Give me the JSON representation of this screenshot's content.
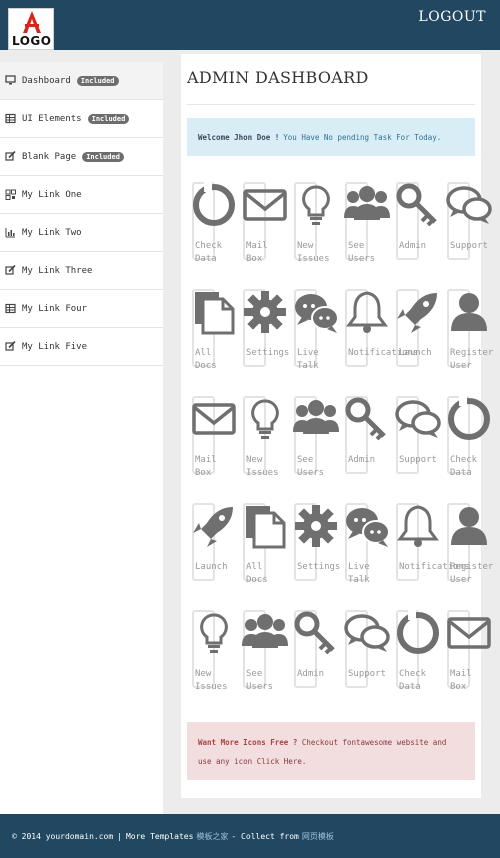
{
  "header": {
    "logo_text": "LOGO",
    "logout_label": "LOGOUT"
  },
  "sidebar": {
    "items": [
      {
        "label": "Dashboard",
        "badge": "Included",
        "icon": "desktop-icon",
        "active": true
      },
      {
        "label": "UI Elements",
        "badge": "Included",
        "icon": "table-icon"
      },
      {
        "label": "Blank Page",
        "badge": "Included",
        "icon": "edit-icon"
      },
      {
        "label": "My Link One",
        "badge": "",
        "icon": "qrcode-icon"
      },
      {
        "label": "My Link Two",
        "badge": "",
        "icon": "bar-chart-icon"
      },
      {
        "label": "My Link Three",
        "badge": "",
        "icon": "edit-icon"
      },
      {
        "label": "My Link Four",
        "badge": "",
        "icon": "table-icon"
      },
      {
        "label": "My Link Five",
        "badge": "",
        "icon": "edit-icon"
      }
    ]
  },
  "main": {
    "title": "ADMIN DASHBOARD",
    "info_alert": {
      "bold": "Welcome Jhon Doe !",
      "text": "You Have No pending Task For Today."
    },
    "tiles": [
      [
        {
          "label": "Check\nData",
          "icon": "circle-notch-icon"
        },
        {
          "label": "Mail\nBox",
          "icon": "envelope-icon"
        },
        {
          "label": "New\nIssues",
          "icon": "lightbulb-icon"
        },
        {
          "label": "See\nUsers",
          "icon": "users-icon"
        },
        {
          "label": "Admin",
          "icon": "key-icon"
        },
        {
          "label": "Support",
          "icon": "comments-icon"
        }
      ],
      [
        {
          "label": "All\nDocs",
          "icon": "files-icon"
        },
        {
          "label": "Settings",
          "icon": "gear-icon"
        },
        {
          "label": "Live\nTalk",
          "icon": "chat-bubbles-icon"
        },
        {
          "label": "Notifications",
          "icon": "bell-icon"
        },
        {
          "label": "Launch",
          "icon": "rocket-icon"
        },
        {
          "label": "Register\nUser",
          "icon": "user-icon"
        }
      ],
      [
        {
          "label": "Mail\nBox",
          "icon": "envelope-icon"
        },
        {
          "label": "New\nIssues",
          "icon": "lightbulb-icon"
        },
        {
          "label": "See\nUsers",
          "icon": "users-icon"
        },
        {
          "label": "Admin",
          "icon": "key-icon"
        },
        {
          "label": "Support",
          "icon": "comments-icon"
        },
        {
          "label": "Check\nData",
          "icon": "circle-notch-icon"
        }
      ],
      [
        {
          "label": "Launch",
          "icon": "rocket-icon"
        },
        {
          "label": "All\nDocs",
          "icon": "files-icon"
        },
        {
          "label": "Settings",
          "icon": "gear-icon"
        },
        {
          "label": "Live\nTalk",
          "icon": "chat-bubbles-icon"
        },
        {
          "label": "Notifications",
          "icon": "bell-icon"
        },
        {
          "label": "Register\nUser",
          "icon": "user-icon"
        }
      ],
      [
        {
          "label": "New\nIssues",
          "icon": "lightbulb-icon"
        },
        {
          "label": "See\nUsers",
          "icon": "users-icon"
        },
        {
          "label": "Admin",
          "icon": "key-icon"
        },
        {
          "label": "Support",
          "icon": "comments-icon"
        },
        {
          "label": "Check\nData",
          "icon": "circle-notch-icon"
        },
        {
          "label": "Mail\nBox",
          "icon": "envelope-icon"
        }
      ]
    ],
    "danger_alert": {
      "bold": "Want More Icons Free ?",
      "text": "Checkout fontawesome website and use any icon",
      "link": "Click Here."
    }
  },
  "footer": {
    "copyright": "© 2014 yourdomain.com",
    "sep": "|",
    "more_templates": "More Templates",
    "link1": "模板之家",
    "collect": "- Collect from",
    "link2": "网页模板"
  },
  "colors": {
    "topbar": "#214761",
    "info_bg": "#d9edf7",
    "danger_bg": "#f2dede",
    "icon": "#6f6f6f"
  }
}
